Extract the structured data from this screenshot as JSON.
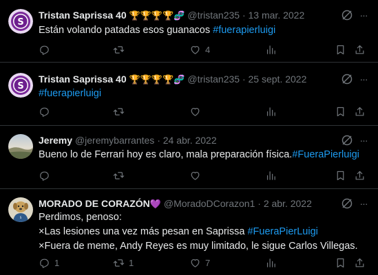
{
  "tweets": [
    {
      "name": "Tristan Saprissa 40",
      "badges": [
        "🏆",
        "🏆",
        "🏆",
        "🏆"
      ],
      "dna": "🧬",
      "handle": "@tristan235",
      "sep": "·",
      "date": "13 mar. 2022",
      "text": "Están volando patadas esos guanacos ",
      "hashtag": "#fuerapierluigi",
      "line2": "",
      "line2_tag": "",
      "line3": "",
      "reply_count": "",
      "retweet_count": "",
      "like_count": "4",
      "avatar": "saprissa-logo"
    },
    {
      "name": "Tristan Saprissa 40",
      "badges": [
        "🏆",
        "🏆",
        "🏆",
        "🏆"
      ],
      "dna": "🧬",
      "handle": "@tristan235",
      "sep": "·",
      "date": "25 sept. 2022",
      "text": "",
      "hashtag": "#fuerapierluigi",
      "reply_count": "",
      "retweet_count": "",
      "like_count": "",
      "avatar": "saprissa-logo"
    },
    {
      "name": "Jeremy",
      "handle": "@jeremybarrantes",
      "sep": "·",
      "date": "24 abr. 2022",
      "text": "Bueno lo de Ferrari hoy es claro, mala preparación física.",
      "hashtag": "#FueraPierluigi",
      "reply_count": "",
      "retweet_count": "",
      "like_count": "",
      "avatar": "landscape-photo"
    },
    {
      "name": "MORADO DE CORAZÓN",
      "heart": "💜",
      "handle": "@MoradoDCorazon1",
      "sep": "·",
      "date": "2 abr. 2022",
      "line1": "Perdimos, penoso:",
      "line2": "×Las lesiones una vez más pesan en Saprissa ",
      "line2_tag": "#FueraPierLuigi",
      "line3": "×Fuera de meme, Andy Reyes es muy limitado, le sigue Carlos Villegas.",
      "reply_count": "1",
      "retweet_count": "1",
      "like_count": "7",
      "avatar": "dog-photo"
    }
  ],
  "icons": {
    "reply": "reply-icon",
    "retweet": "retweet-icon",
    "like": "heart-icon",
    "views": "views-icon",
    "bookmark": "bookmark-icon",
    "share": "share-icon",
    "grok": "grok-icon",
    "more": "more-icon"
  },
  "colors": {
    "background": "#000000",
    "text": "#e7e9ea",
    "muted": "#71767b",
    "link": "#1d9bf0",
    "border": "#2f3336"
  }
}
